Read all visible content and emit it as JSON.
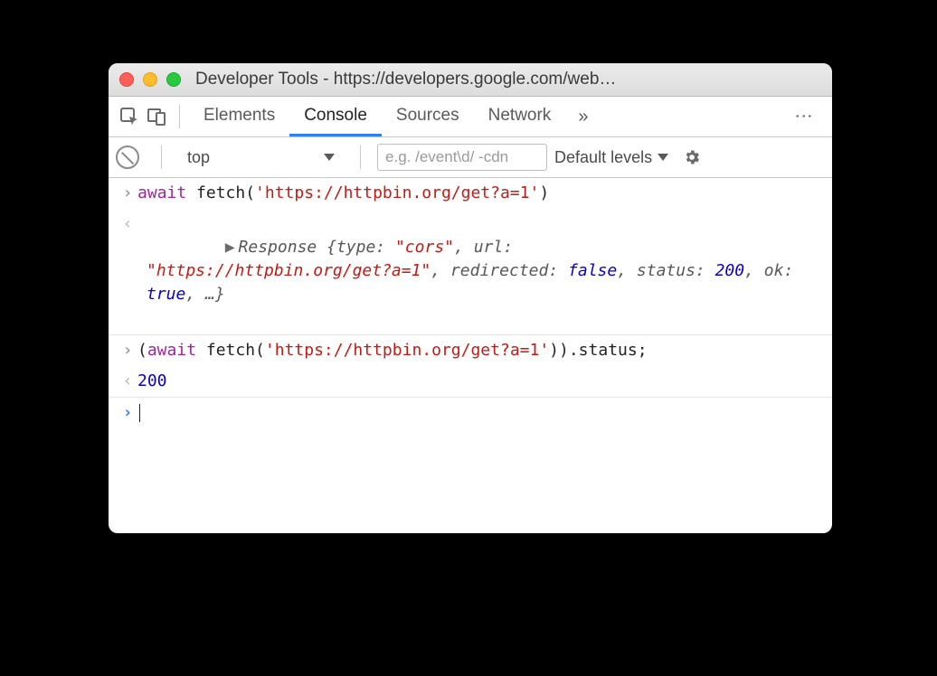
{
  "window": {
    "title": "Developer Tools - https://developers.google.com/web…"
  },
  "tabs": {
    "elements": "Elements",
    "console": "Console",
    "sources": "Sources",
    "network": "Network",
    "overflow": "»"
  },
  "toolbar": {
    "context": "top",
    "filter_placeholder": "e.g. /event\\d/ -cdn",
    "levels": "Default levels"
  },
  "console": {
    "line1": {
      "kw": "await",
      "fn": " fetch(",
      "str": "'https://httpbin.org/get?a=1'",
      "close": ")"
    },
    "line2": {
      "obj_name": "Response ",
      "open": "{",
      "p1k": "type: ",
      "p1v": "\"cors\"",
      "p2k": "url: ",
      "p2v": "\"https://httpbin.org/get?a=1\"",
      "p3k": "redirected: ",
      "p3v": "false",
      "p4k": "status: ",
      "p4v": "200",
      "p5k": "ok: ",
      "p5v": "true",
      "rest": ", …}",
      "comma": ", "
    },
    "line3": {
      "open": "(",
      "kw": "await",
      "fn": " fetch(",
      "str": "'https://httpbin.org/get?a=1'",
      "close": ")).status;"
    },
    "line4": {
      "value": "200"
    }
  }
}
